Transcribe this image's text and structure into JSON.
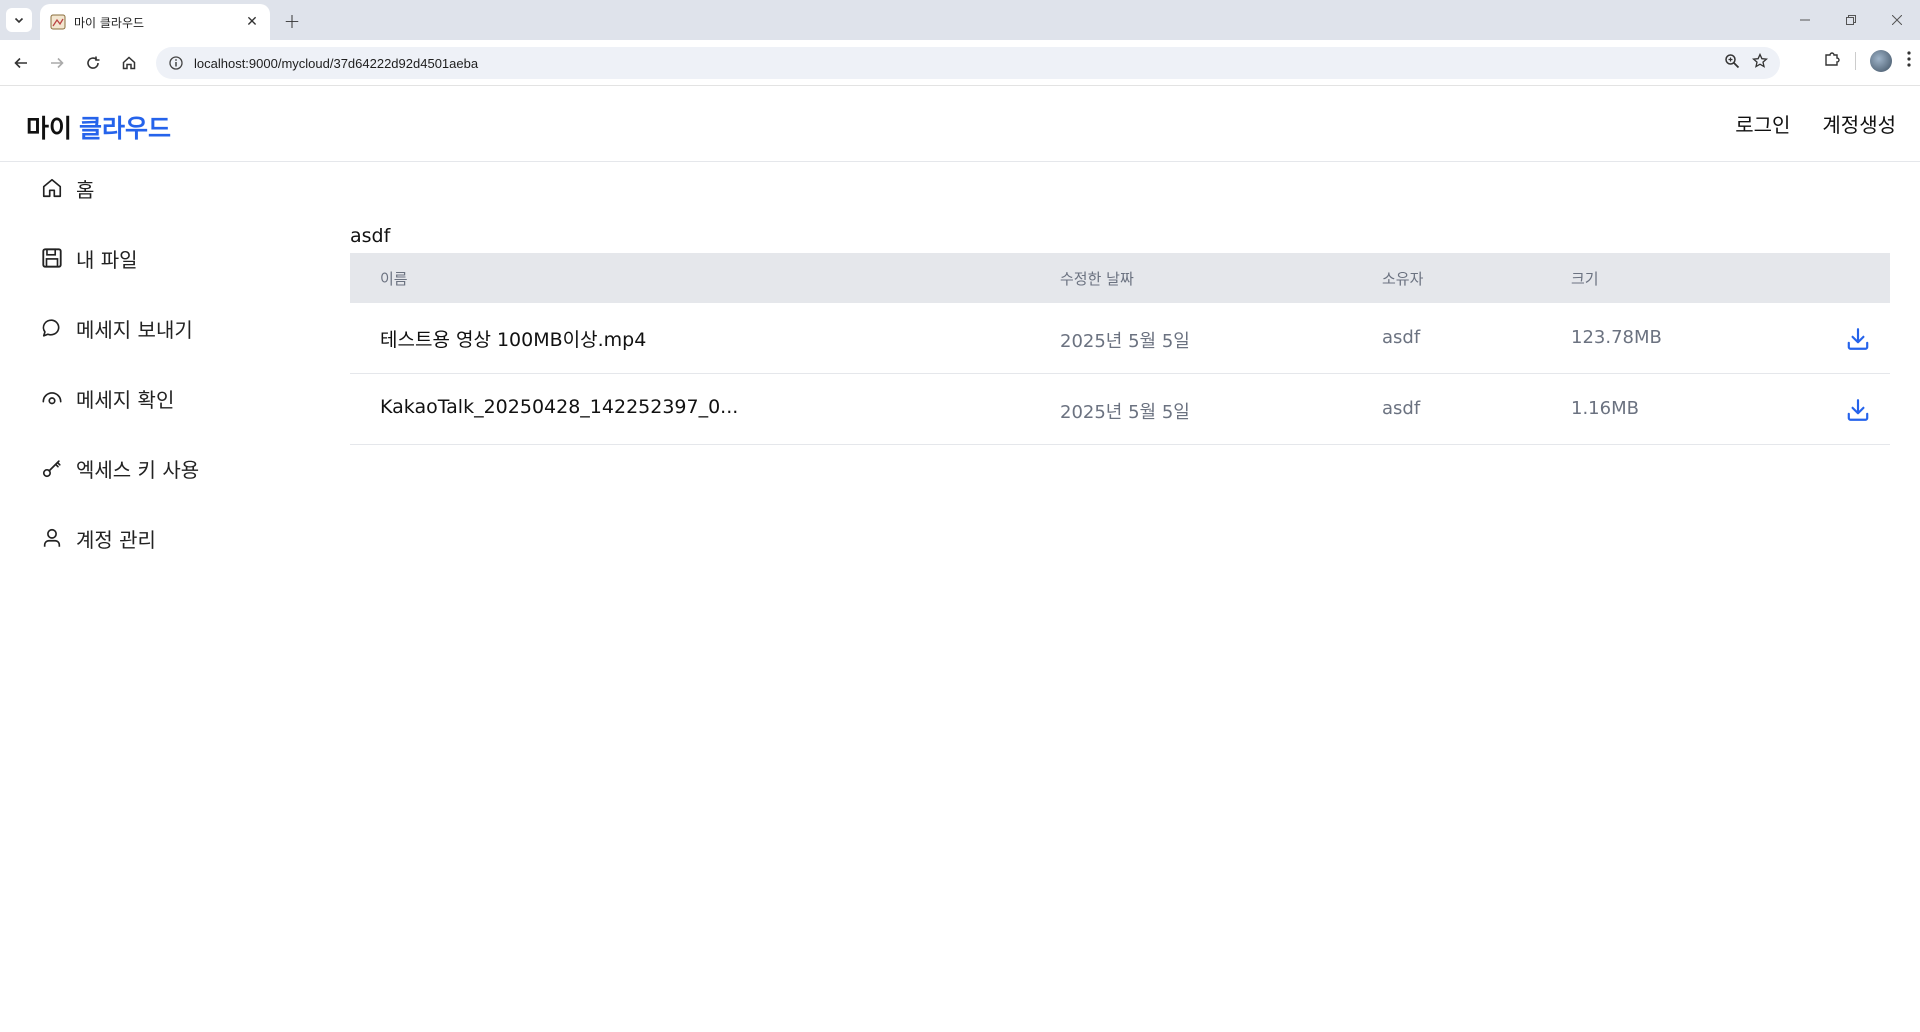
{
  "browser": {
    "tab_title": "마이 클라우드",
    "new_tab_symbol": "+",
    "url": "localhost:9000/mycloud/37d64222d92d4501aeba"
  },
  "header": {
    "brand_part1": "마이",
    "brand_part2": "클라우드",
    "brand_part2_color": "#2563eb",
    "login_label": "로그인",
    "signup_label": "계정생성"
  },
  "sidebar": {
    "items": [
      {
        "label": "홈",
        "icon": "home-icon"
      },
      {
        "label": "내 파일",
        "icon": "save-icon"
      },
      {
        "label": "메세지 보내기",
        "icon": "chat-bubble-icon"
      },
      {
        "label": "메세지 확인",
        "icon": "eye-arc-icon"
      },
      {
        "label": "엑세스 키 사용",
        "icon": "key-icon"
      },
      {
        "label": "계정 관리",
        "icon": "user-icon"
      }
    ]
  },
  "main": {
    "folder_title": "asdf",
    "columns": {
      "name": "이름",
      "modified": "수정한 날짜",
      "owner": "소유자",
      "size": "크기"
    },
    "rows": [
      {
        "name": "테스트용 영상 100MB이상.mp4",
        "modified": "2025년 5월 5일",
        "owner": "asdf",
        "size": "123.78MB"
      },
      {
        "name": "KakaoTalk_20250428_142252397_0...",
        "modified": "2025년 5월 5일",
        "owner": "asdf",
        "size": "1.16MB"
      }
    ],
    "download_icon": "download-icon",
    "accent_color": "#2563eb"
  }
}
